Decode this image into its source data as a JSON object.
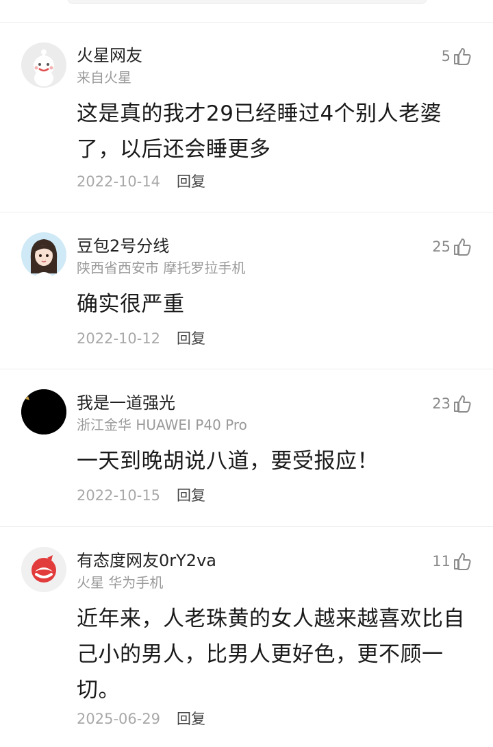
{
  "comments": [
    {
      "username": "火星网友",
      "source": "来自火星",
      "likes": "5",
      "content": "这是真的我才29已经睡过4个别人老婆了，以后还会睡更多",
      "date": "2022-10-14",
      "reply_label": "回复",
      "avatar": "mars-mascot-avatar"
    },
    {
      "username": "豆包2号分线",
      "source": "陕西省西安市 摩托罗拉手机",
      "likes": "25",
      "content": "确实很严重",
      "date": "2022-10-12",
      "reply_label": "回复",
      "avatar": "cartoon-girl-avatar"
    },
    {
      "username": "我是一道强光",
      "source": "浙江金华 HUAWEI P40 Pro",
      "likes": "23",
      "content": "一天到晚胡说八道，要受报应！",
      "date": "2022-10-15",
      "reply_label": "回复",
      "avatar": "black-avatar"
    },
    {
      "username": "有态度网友0rY2va",
      "source": "火星 华为手机",
      "likes": "11",
      "content": "近年来，人老珠黄的女人越来越喜欢比自己小的男人，比男人更好色，更不顾一切。",
      "date": "2025-06-29",
      "reply_label": "回复",
      "avatar": "netease-logo-avatar"
    }
  ],
  "colors": {
    "text_primary": "#1a1a1a",
    "text_secondary": "#9a9a9a",
    "divider": "#ececec"
  }
}
